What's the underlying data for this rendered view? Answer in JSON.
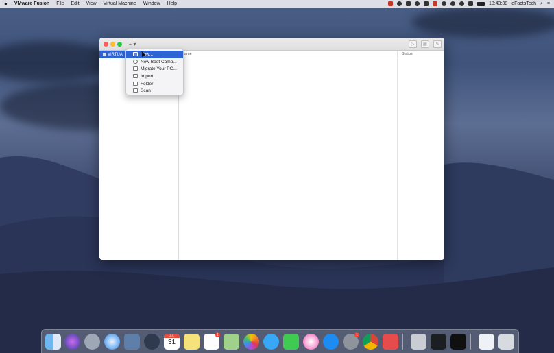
{
  "menubar": {
    "apple_icon": "apple-icon",
    "app_name": "VMware Fusion",
    "menus": [
      "File",
      "Edit",
      "View",
      "Virtual Machine",
      "Window",
      "Help"
    ],
    "clock": "18:43:38",
    "user": "eFactsTech"
  },
  "window": {
    "add_button_label": "+ ▾",
    "sidebar_selected_label": "VIRTUA",
    "columns": {
      "name": "Name",
      "status": "Status"
    },
    "toolbar_icons": [
      "play-icon",
      "snapshot-icon",
      "settings-icon"
    ]
  },
  "dropdown": {
    "items": [
      {
        "label": "New...",
        "icon": "new-vm-icon"
      },
      {
        "label": "New Boot Camp...",
        "icon": "bootcamp-icon"
      },
      {
        "label": "Migrate Your PC...",
        "icon": "migrate-icon"
      },
      {
        "label": "Import...",
        "icon": "import-icon"
      },
      {
        "label": "Folder",
        "icon": "folder-icon"
      },
      {
        "label": "Scan",
        "icon": "scan-icon"
      }
    ],
    "active_index": 0
  },
  "dock": {
    "calendar_month": "JUL",
    "calendar_day": "31",
    "badges": {
      "reminders": "1",
      "system_preferences": "1"
    },
    "apps": [
      "Finder",
      "Siri",
      "Launchpad",
      "Safari",
      "Preview",
      "QuickTime",
      "Calendar",
      "Notes",
      "Reminders",
      "Maps",
      "Photos",
      "Messages",
      "FaceTime",
      "iTunes",
      "App Store",
      "System Preferences",
      "Chrome",
      "VMware Fusion",
      "Disk Utility",
      "Activity Monitor",
      "Terminal",
      "Downloads",
      "Trash"
    ]
  },
  "colors": {
    "accent": "#2f63d4",
    "menubar": "#e8e8ec"
  }
}
